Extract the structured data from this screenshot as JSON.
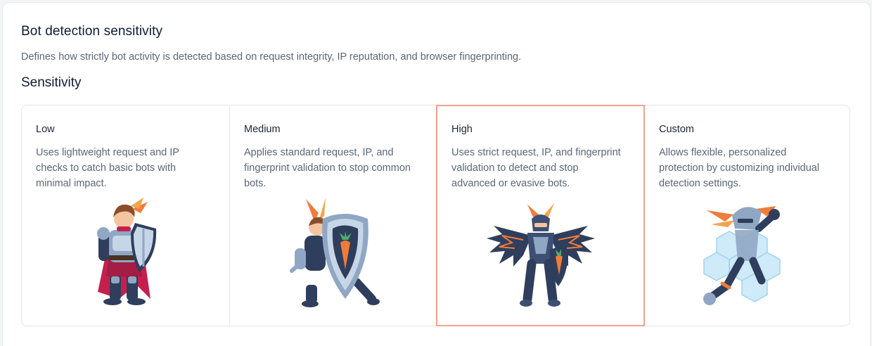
{
  "header": {
    "title": "Bot detection sensitivity",
    "description": "Defines how strictly bot activity is detected based on request integrity, IP reputation, and browser fingerprinting.",
    "section_title": "Sensitivity"
  },
  "options": [
    {
      "name": "Low",
      "description": "Uses lightweight request and IP checks to catch basic bots with minimal impact.",
      "illustration": "knight-with-shield-icon",
      "selected": false
    },
    {
      "name": "Medium",
      "description": "Applies standard request, IP, and fingerprint validation to stop common bots.",
      "illustration": "knight-behind-large-shield-icon",
      "selected": false
    },
    {
      "name": "High",
      "description": "Uses strict request, IP, and fingerprint validation to detect and stop advanced or evasive bots.",
      "illustration": "armored-winged-knight-icon",
      "selected": true
    },
    {
      "name": "Custom",
      "description": "Allows flexible, personalized protection by customizing individual detection settings.",
      "illustration": "knight-with-hexagon-shields-icon",
      "selected": false
    }
  ],
  "colors": {
    "selected_border": "#f2a08f",
    "armor_dark": "#2f3e5c",
    "armor_steel": "#8fa7c4",
    "accent_orange": "#f07c3a",
    "cape_red": "#c4204f",
    "shield_blue": "#9fd3ef"
  }
}
